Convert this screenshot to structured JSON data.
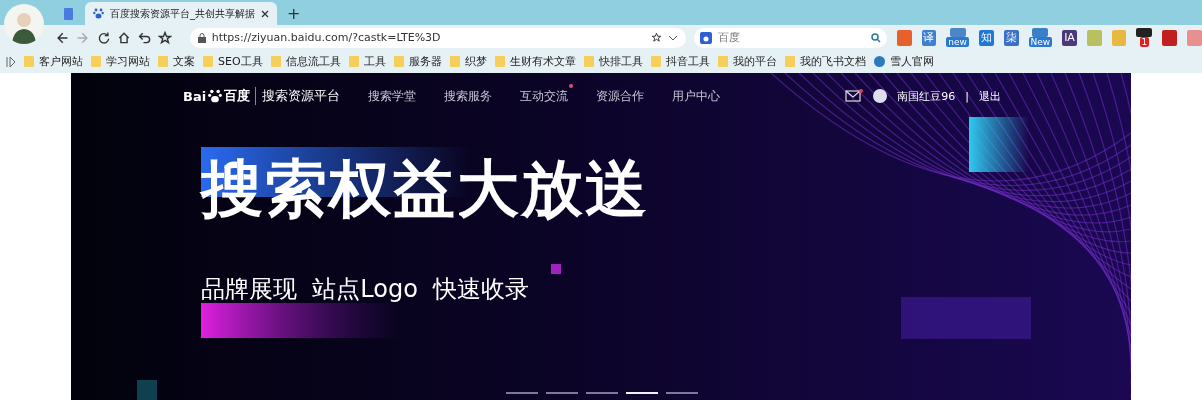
{
  "browser": {
    "tabs": [
      {
        "kind": "icon",
        "selected": false
      },
      {
        "kind": "page",
        "title": "百度搜索资源平台_共创共享解据",
        "selected": true
      }
    ],
    "new_tab": "+",
    "address": "https://ziyuan.baidu.com/?castk=LTE%3D",
    "search": {
      "placeholder": "百度"
    },
    "extensions": [
      {
        "kind": "plain",
        "color": "#e8602c"
      },
      {
        "kind": "plain",
        "label": "译",
        "color": "#3f7fd0"
      },
      {
        "kind": "badge",
        "badge": "new",
        "color": "#4a86c8"
      },
      {
        "kind": "plain",
        "label": "知",
        "color": "#1e78d8"
      },
      {
        "kind": "plain",
        "label": "柒",
        "color": "#3a70c8"
      },
      {
        "kind": "badge",
        "badge": "New",
        "color": "#3a80c8"
      },
      {
        "kind": "plain",
        "label": "IA",
        "color": "#4a3a7a"
      },
      {
        "kind": "plain",
        "color": "#b8c060"
      },
      {
        "kind": "plain",
        "color": "#e8b840"
      },
      {
        "kind": "badge",
        "badge": "1",
        "color": "#222222"
      },
      {
        "kind": "plain",
        "color": "#c02020"
      },
      {
        "kind": "plain",
        "color": "#e89090"
      }
    ],
    "bookmarks": [
      {
        "kind": "folder",
        "label": "客户网站"
      },
      {
        "kind": "folder",
        "label": "学习网站"
      },
      {
        "kind": "folder",
        "label": "文案"
      },
      {
        "kind": "folder",
        "label": "SEO工具"
      },
      {
        "kind": "folder",
        "label": "信息流工具"
      },
      {
        "kind": "folder",
        "label": "工具"
      },
      {
        "kind": "folder",
        "label": "服务器"
      },
      {
        "kind": "folder",
        "label": "织梦"
      },
      {
        "kind": "folder",
        "label": "生财有术文章"
      },
      {
        "kind": "folder",
        "label": "快排工具"
      },
      {
        "kind": "folder",
        "label": "抖音工具"
      },
      {
        "kind": "folder",
        "label": "我的平台"
      },
      {
        "kind": "folder",
        "label": "我的飞书文档"
      },
      {
        "kind": "site",
        "label": "雪人官网"
      }
    ]
  },
  "site": {
    "logo": {
      "latin": "Bai",
      "cn": "百度",
      "product": "搜索资源平台"
    },
    "nav": [
      {
        "label": "搜索学堂",
        "dot": false
      },
      {
        "label": "搜索服务",
        "dot": false
      },
      {
        "label": "互动交流",
        "dot": true
      },
      {
        "label": "资源合作",
        "dot": false
      },
      {
        "label": "用户中心",
        "dot": false
      }
    ],
    "mail_unread": true,
    "user": "南国红豆96",
    "separator": "|",
    "logout": "退出",
    "banner": {
      "title": "搜索权益大放送",
      "subtitle": "品牌展现  站点Logo  快速收录"
    },
    "slides": [
      {
        "selected": false
      },
      {
        "selected": false
      },
      {
        "selected": false
      },
      {
        "selected": true
      },
      {
        "selected": false
      }
    ]
  }
}
